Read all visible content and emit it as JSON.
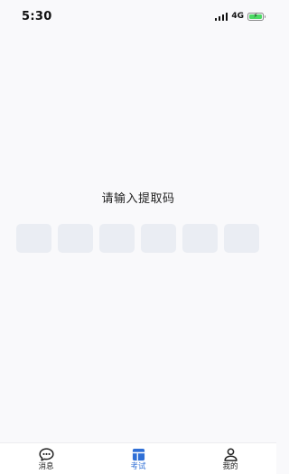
{
  "status_bar": {
    "time": "5:30",
    "network": "4G",
    "icons": [
      "signal-icon",
      "battery-charging-icon"
    ]
  },
  "prompt": "请输入提取码",
  "code_input": {
    "length": 6,
    "values": [
      "",
      "",
      "",
      "",
      "",
      ""
    ]
  },
  "tab_bar": {
    "tabs": [
      {
        "label": "消息",
        "icon": "message-icon",
        "active": false
      },
      {
        "label": "考试",
        "icon": "exam-icon",
        "active": true
      },
      {
        "label": "我的",
        "icon": "user-icon",
        "active": false
      }
    ]
  },
  "colors": {
    "accent": "#2f6fd6",
    "code_box_bg": "#eaedf3",
    "page_bg": "#f9f9fb",
    "battery": "#4cd964"
  }
}
